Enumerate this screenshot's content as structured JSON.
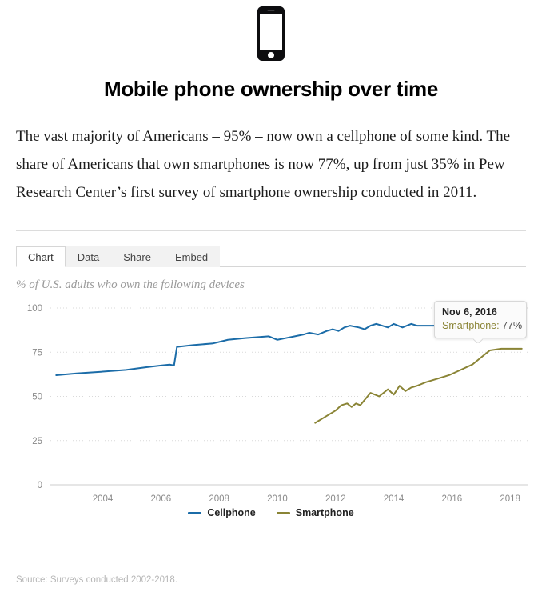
{
  "hero": {
    "icon": "mobile-phone-icon"
  },
  "header": {
    "title": "Mobile phone ownership over time"
  },
  "intro": {
    "paragraph": "The vast majority of Americans – 95% – now own a cellphone of some kind. The share of Americans that own smartphones is now 77%, up from just 35% in Pew Research Center’s first survey of smartphone ownership conducted in 2011."
  },
  "tabs": {
    "items": [
      {
        "label": "Chart",
        "active": true
      },
      {
        "label": "Data",
        "active": false
      },
      {
        "label": "Share",
        "active": false
      },
      {
        "label": "Embed",
        "active": false
      }
    ]
  },
  "tooltip": {
    "date": "Nov 6, 2016",
    "series_label": "Smartphone",
    "series_value": "77%",
    "row_text": "Smartphone: 77%",
    "color": "#8a8435"
  },
  "footer": {
    "source": "Source: Surveys conducted 2002-2018."
  },
  "colors": {
    "cellphone": "#1b6ca8",
    "smartphone": "#8a8435",
    "gridline": "#d9d9d9",
    "axis": "#cccccc",
    "tick_text": "#8a8a8a",
    "subtitle": "#9a9a9a"
  },
  "chart_data": {
    "type": "line",
    "title": "Mobile phone ownership over time",
    "subtitle": "% of U.S. adults who own the following devices",
    "xlabel": "",
    "ylabel": "% of U.S. adults",
    "xlim": [
      2002.2,
      2018.6
    ],
    "ylim": [
      0,
      100
    ],
    "yticks": [
      0,
      25,
      50,
      75,
      100
    ],
    "xticks": [
      2004,
      2006,
      2008,
      2010,
      2012,
      2014,
      2016,
      2018
    ],
    "grid": "horizontal-dotted",
    "legend_position": "bottom-center",
    "source": "Source: Surveys conducted 2002-2018.",
    "series": [
      {
        "name": "Cellphone",
        "color": "#1b6ca8",
        "x": [
          2002.4,
          2003.1,
          2004.0,
          2004.8,
          2005.5,
          2006.0,
          2006.3,
          2006.45,
          2006.55,
          2007.1,
          2007.8,
          2008.3,
          2008.9,
          2009.3,
          2009.7,
          2010.0,
          2010.3,
          2010.6,
          2010.9,
          2011.1,
          2011.4,
          2011.7,
          2011.9,
          2012.1,
          2012.3,
          2012.5,
          2012.8,
          2013.0,
          2013.2,
          2013.4,
          2013.6,
          2013.8,
          2014.0,
          2014.15,
          2014.3,
          2014.45,
          2014.6,
          2014.8,
          2015.0,
          2015.2,
          2015.4,
          2015.6,
          2015.8,
          2016.0,
          2016.3,
          2016.6,
          2016.9,
          2017.2,
          2017.6,
          2018.0,
          2018.4
        ],
        "y": [
          62,
          63,
          64,
          65,
          66.5,
          67.5,
          68,
          67.5,
          78,
          79,
          80,
          82,
          83,
          83.5,
          84,
          82,
          83,
          84,
          85,
          86,
          85,
          87,
          88,
          87,
          89,
          90,
          89,
          88,
          90,
          91,
          90,
          89,
          91,
          90,
          89,
          90,
          91,
          90,
          90,
          90,
          90,
          92,
          91,
          92,
          95,
          95,
          95,
          95,
          95,
          95,
          95
        ]
      },
      {
        "name": "Smartphone",
        "color": "#8a8435",
        "x": [
          2011.3,
          2011.7,
          2012.0,
          2012.2,
          2012.4,
          2012.55,
          2012.7,
          2012.85,
          2013.0,
          2013.2,
          2013.5,
          2013.8,
          2014.0,
          2014.2,
          2014.4,
          2014.6,
          2014.8,
          2015.1,
          2015.5,
          2015.9,
          2016.3,
          2016.7,
          2017.0,
          2017.3,
          2017.7,
          2018.1,
          2018.4
        ],
        "y": [
          35,
          39,
          42,
          45,
          46,
          44,
          46,
          45,
          48,
          52,
          50,
          54,
          51,
          56,
          53,
          55,
          56,
          58,
          60,
          62,
          65,
          68,
          72,
          76,
          77,
          77,
          77
        ]
      }
    ],
    "annotation": {
      "x": 2016.85,
      "y": 77,
      "date": "Nov 6, 2016",
      "label": "Smartphone: 77%"
    }
  }
}
